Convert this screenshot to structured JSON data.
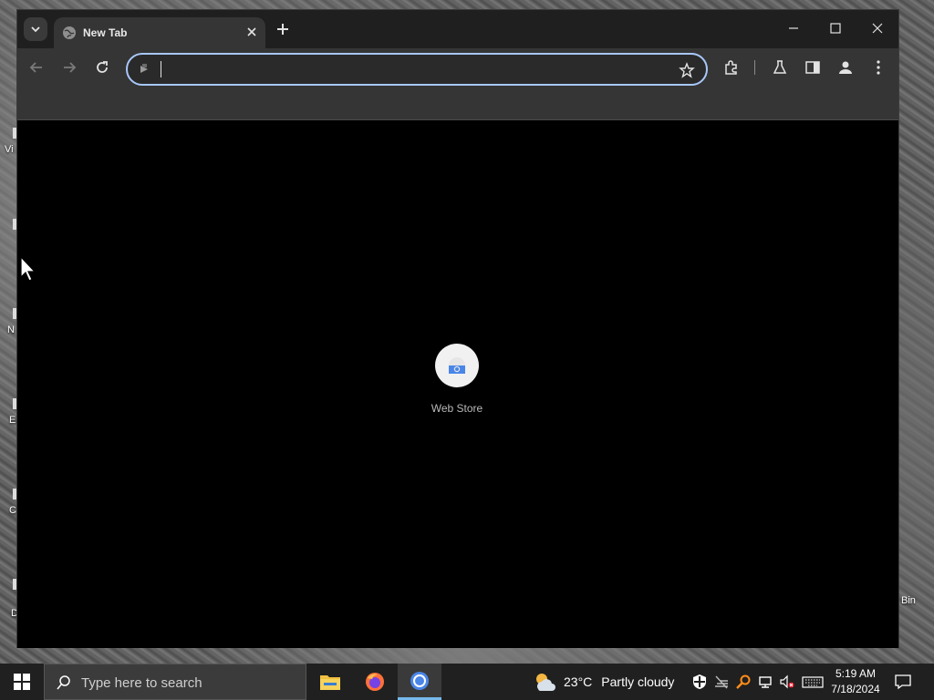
{
  "desktop": {
    "fragments": [
      "Vi",
      "N",
      "E",
      "C",
      "D",
      "Bin"
    ]
  },
  "browser": {
    "tab": {
      "title": "New Tab",
      "favicon": "globe-icon"
    },
    "omnibox": {
      "value": "",
      "placeholder": ""
    },
    "toolbar_icons": [
      "back-icon",
      "forward-icon",
      "reload-icon",
      "star-icon",
      "extensions-icon",
      "labs-icon",
      "side-panel-icon",
      "profile-icon",
      "menu-icon"
    ],
    "shortcuts": [
      {
        "label": "Web Store",
        "icon": "web-store-icon"
      }
    ]
  },
  "taskbar": {
    "search_placeholder": "Type here to search",
    "apps": [
      "file-explorer-icon",
      "firefox-icon",
      "chrome-icon"
    ],
    "weather": {
      "temp": "23°C",
      "condition": "Partly cloudy"
    },
    "clock": {
      "time": "5:19 AM",
      "date": "7/18/2024"
    }
  },
  "colors": {
    "accent": "#a8c7fa",
    "taskbar": "#202020",
    "tab_active": "#353535"
  }
}
